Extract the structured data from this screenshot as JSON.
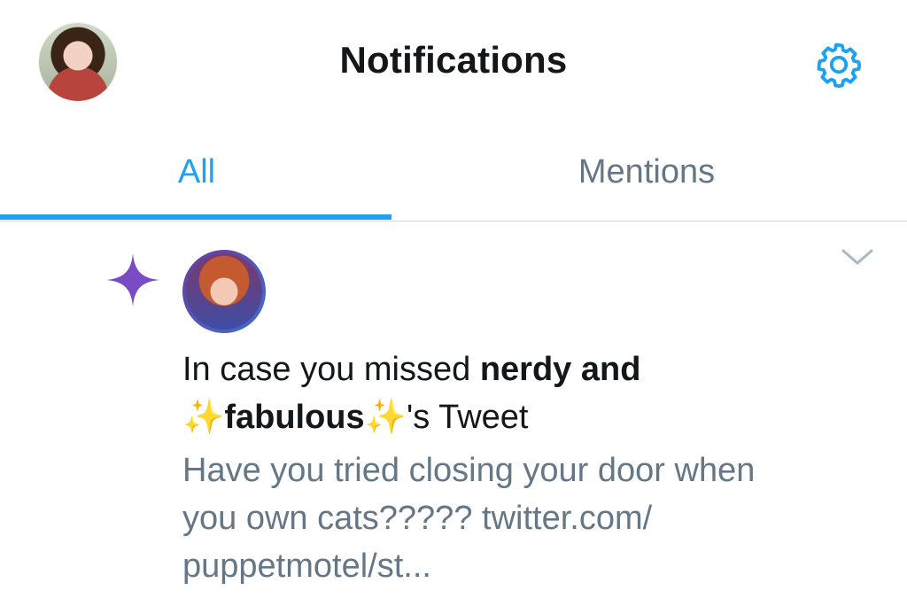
{
  "header": {
    "title": "Notifications",
    "avatar_icon": "user-avatar",
    "settings_icon": "gear-icon"
  },
  "tabs": [
    {
      "label": "All",
      "active": true
    },
    {
      "label": "Mentions",
      "active": false
    }
  ],
  "notification": {
    "icon": "sparkle-icon",
    "avatar_icon": "user-avatar",
    "menu_icon": "chevron-down-icon",
    "headline_prefix": "In case you missed ",
    "author_line1": "nerdy and",
    "author_emoji": "✨",
    "author_name": "fabulous",
    "headline_suffix": "'s Tweet",
    "tweet_line1": "Have you tried closing your door when",
    "tweet_line2": "you own cats????? twitter.com/",
    "tweet_line3": "puppetmotel/st..."
  },
  "colors": {
    "accent": "#1da1f2",
    "secondary_text": "#657786",
    "primary_text": "#14171a",
    "sparkle": "#794bc4"
  }
}
